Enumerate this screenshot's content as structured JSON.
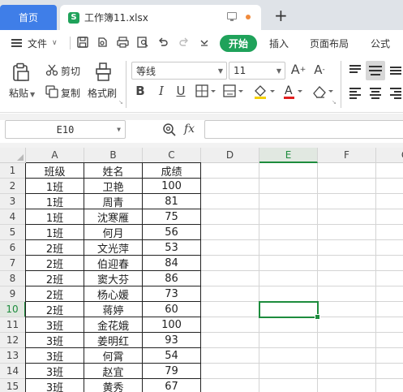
{
  "tabs": {
    "home": "首页",
    "file": "工作簿11.xlsx",
    "file_logo": "S",
    "new_tab": "+"
  },
  "menu": {
    "file_menu": "文件",
    "start": "开始",
    "insert": "插入",
    "page_layout": "页面布局",
    "formula": "公式"
  },
  "ribbon": {
    "paste": "粘贴",
    "cut": "剪切",
    "copy": "复制",
    "format_painter": "格式刷",
    "font_name": "等线",
    "font_size": "11",
    "bold": "B",
    "italic": "I",
    "underline": "U"
  },
  "formula_bar": {
    "name_box": "E10",
    "fx": "fx",
    "value": ""
  },
  "sheet": {
    "columns": [
      "A",
      "B",
      "C",
      "D",
      "E",
      "F",
      "G"
    ],
    "selected_column": "E",
    "selected_row": 10,
    "rows": [
      {
        "n": "1",
        "a": "班级",
        "b": "姓名",
        "c": "成绩"
      },
      {
        "n": "2",
        "a": "1班",
        "b": "卫艳",
        "c": "100"
      },
      {
        "n": "3",
        "a": "1班",
        "b": "周青",
        "c": "81"
      },
      {
        "n": "4",
        "a": "1班",
        "b": "沈寒雁",
        "c": "75"
      },
      {
        "n": "5",
        "a": "1班",
        "b": "何月",
        "c": "56"
      },
      {
        "n": "6",
        "a": "2班",
        "b": "文光萍",
        "c": "53"
      },
      {
        "n": "7",
        "a": "2班",
        "b": "伯迎春",
        "c": "84"
      },
      {
        "n": "8",
        "a": "2班",
        "b": "窦大芬",
        "c": "86"
      },
      {
        "n": "9",
        "a": "2班",
        "b": "杨心媛",
        "c": "73"
      },
      {
        "n": "10",
        "a": "2班",
        "b": "蒋婷",
        "c": "60"
      },
      {
        "n": "11",
        "a": "3班",
        "b": "金花娥",
        "c": "100"
      },
      {
        "n": "12",
        "a": "3班",
        "b": "姜明红",
        "c": "93"
      },
      {
        "n": "13",
        "a": "3班",
        "b": "何霄",
        "c": "54"
      },
      {
        "n": "14",
        "a": "3班",
        "b": "赵宜",
        "c": "79"
      },
      {
        "n": "15",
        "a": "3班",
        "b": "黄秀",
        "c": "67"
      }
    ]
  },
  "colors": {
    "accent_green": "#1fa25a",
    "home_tab_blue": "#3f7ee8",
    "selection_green": "#1d8c3d"
  }
}
